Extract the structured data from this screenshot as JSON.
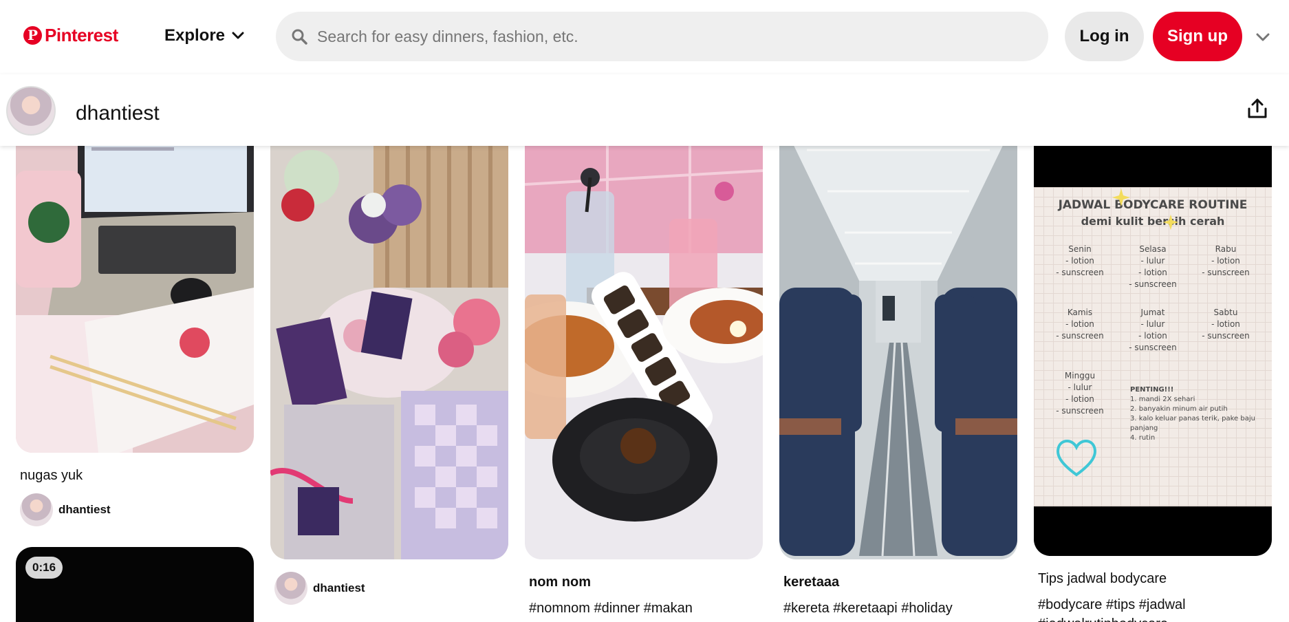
{
  "brand": {
    "logo_text": "Pinterest",
    "color": "#e60023"
  },
  "nav": {
    "explore_label": "Explore"
  },
  "search": {
    "placeholder": "Search for easy dinners, fashion, etc."
  },
  "auth": {
    "login_label": "Log in",
    "signup_label": "Sign up"
  },
  "profile": {
    "username": "dhantiest"
  },
  "pins": [
    {
      "title": "nugas yuk",
      "creator": "dhantiest",
      "description": ""
    },
    {
      "title": "",
      "creator": "dhantiest",
      "description": ""
    },
    {
      "title": "nom nom",
      "creator": "",
      "description": "#nomnom #dinner #makan"
    },
    {
      "title": "keretaaa",
      "creator": "",
      "description": "#kereta #keretaapi #holiday"
    },
    {
      "title": "Tips jadwal bodycare",
      "creator": "",
      "description": "#bodycare #tips #jadwal #jadwalrutinbodycare"
    },
    {
      "title": "",
      "creator": "",
      "description": "",
      "video_duration": "0:16"
    }
  ],
  "bodycare_card": {
    "heading": "JADWAL BODYCARE ROUTINE",
    "subheading": "demi kulit bersih cerah",
    "days": [
      {
        "day": "Senin",
        "items": [
          "- lotion",
          "- sunscreen"
        ]
      },
      {
        "day": "Selasa",
        "items": [
          "- lulur",
          "- lotion",
          "- sunscreen"
        ]
      },
      {
        "day": "Rabu",
        "items": [
          "- lotion",
          "- sunscreen"
        ]
      },
      {
        "day": "Kamis",
        "items": [
          "- lotion",
          "- sunscreen"
        ]
      },
      {
        "day": "Jumat",
        "items": [
          "- lulur",
          "- lotion",
          "- sunscreen"
        ]
      },
      {
        "day": "Sabtu",
        "items": [
          "- lotion",
          "- sunscreen"
        ]
      },
      {
        "day": "Minggu",
        "items": [
          "- lulur",
          "- lotion",
          "- sunscreen"
        ]
      }
    ],
    "notes_heading": "PENTING!!!",
    "notes": [
      "1. mandi 2X sehari",
      "2. banyakin minum air putih",
      "3. kalo keluar panas terik, pake baju panjang",
      "4. rutin"
    ]
  }
}
